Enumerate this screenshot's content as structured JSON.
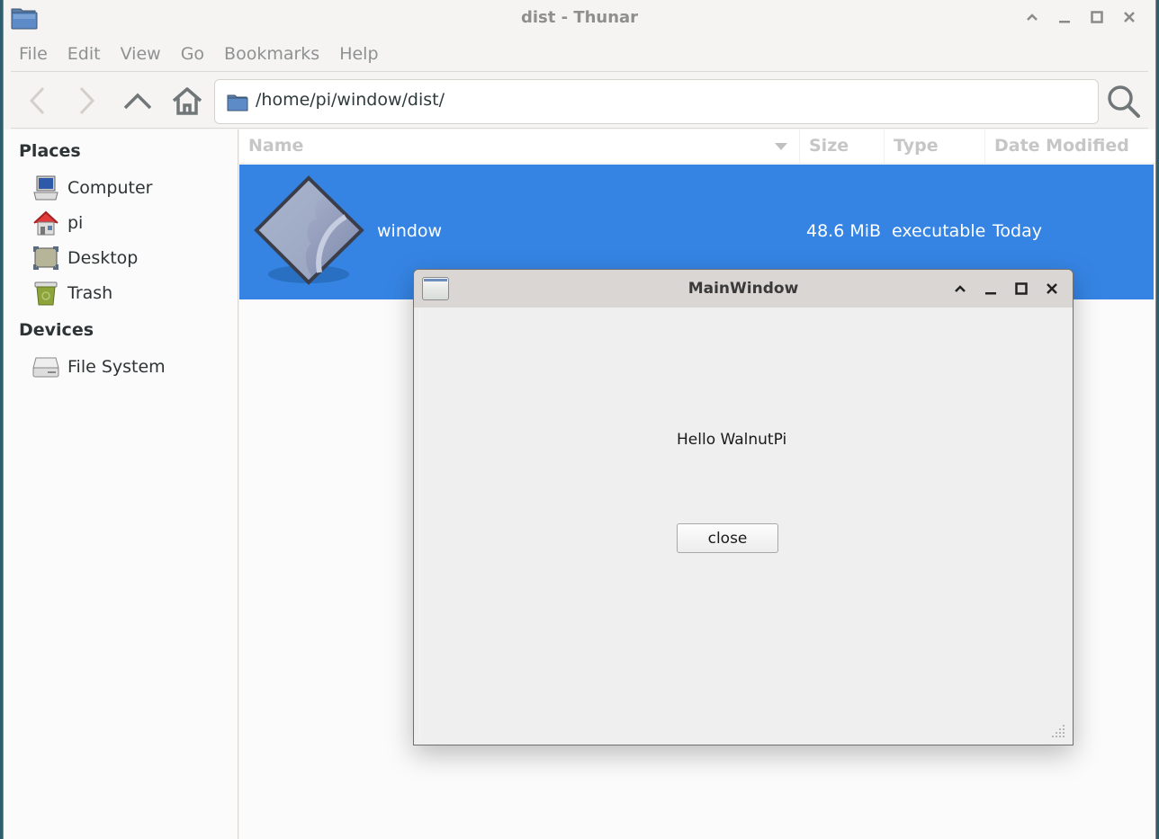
{
  "window": {
    "title": "dist - Thunar",
    "controls": [
      "shade",
      "minimize",
      "maximize",
      "close"
    ]
  },
  "menubar": {
    "items": [
      "File",
      "Edit",
      "View",
      "Go",
      "Bookmarks",
      "Help"
    ]
  },
  "toolbar": {
    "back_icon": "chevron-left-icon",
    "forward_icon": "chevron-right-icon",
    "up_icon": "chevron-up-icon",
    "home_icon": "home-icon",
    "location_path": "/home/pi/window/dist/",
    "search_icon": "search-icon"
  },
  "sidebar": {
    "places_heading": "Places",
    "places": [
      {
        "label": "Computer",
        "icon": "computer-icon"
      },
      {
        "label": "pi",
        "icon": "home-folder-icon"
      },
      {
        "label": "Desktop",
        "icon": "desktop-icon"
      },
      {
        "label": "Trash",
        "icon": "trash-icon"
      }
    ],
    "devices_heading": "Devices",
    "devices": [
      {
        "label": "File System",
        "icon": "drive-icon"
      }
    ]
  },
  "file_list": {
    "columns": [
      "Name",
      "Size",
      "Type",
      "Date Modified"
    ],
    "sort_indicator": "sort-descending-icon",
    "rows": [
      {
        "name": "window",
        "size": "48.6 MiB",
        "type": "executable",
        "date_modified": "Today",
        "icon": "executable-icon",
        "selected": true
      }
    ]
  },
  "dialog": {
    "title": "MainWindow",
    "label": "Hello WalnutPi",
    "button": "close"
  },
  "colors": {
    "selection": "#3584e4",
    "window_bg": "#f5f4f2",
    "dialog_titlebar": "#dad6d3"
  }
}
